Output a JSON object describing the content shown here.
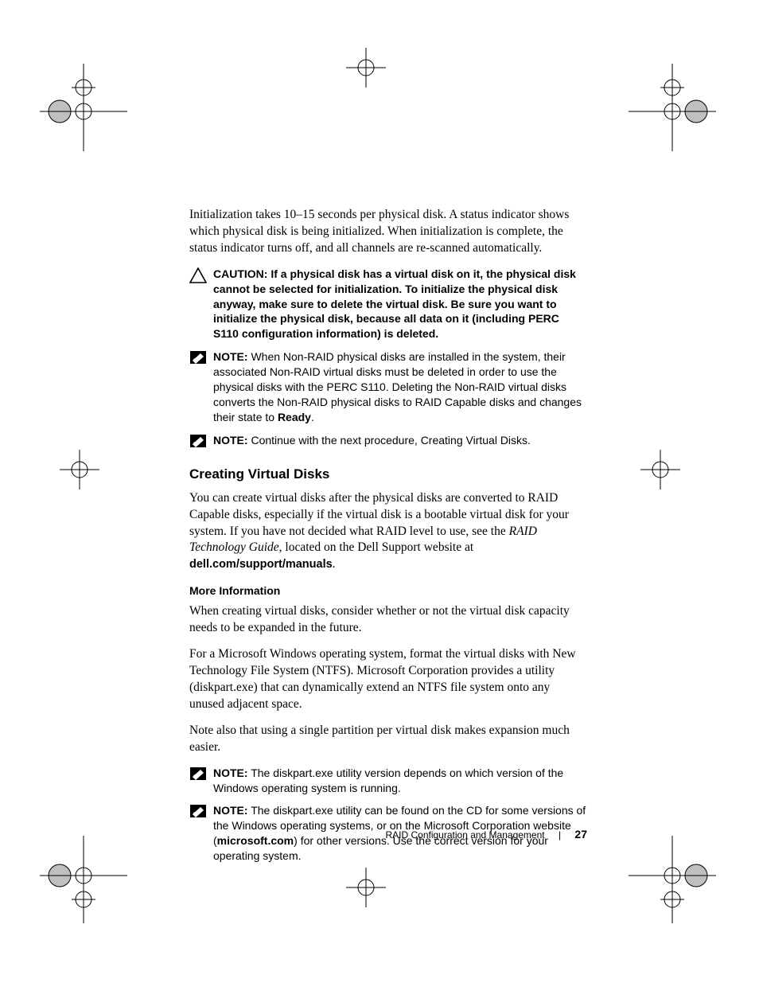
{
  "intro_paragraph": "Initialization takes 10–15 seconds per physical disk. A status indicator shows which physical disk is being initialized. When initialization is complete, the status indicator turns off, and all channels are re-scanned automatically.",
  "caution": {
    "label": "CAUTION:",
    "text": " If a physical disk has a virtual disk on it, the physical disk cannot be selected for initialization. To initialize the physical disk anyway, make sure to delete the virtual disk. Be sure you want to initialize the physical disk, because all data on it (including PERC S110 configuration information) is deleted."
  },
  "note1": {
    "label": "NOTE:",
    "text_a": " When Non-RAID physical disks are installed in the system, their associated Non-RAID virtual disks must be deleted in order to use the physical disks with the PERC S110. Deleting the Non-RAID virtual disks converts the Non-RAID physical disks to RAID Capable disks and changes their state to ",
    "bold_word": "Ready",
    "text_b": "."
  },
  "note2": {
    "label": "NOTE:",
    "text": " Continue with the next procedure, Creating Virtual Disks."
  },
  "section_heading": "Creating Virtual Disks",
  "section_para_a": "You can create virtual disks after the physical disks are converted to RAID Capable disks, especially if the virtual disk is a bootable virtual disk for your system. If you have not decided what RAID level to use, see the ",
  "section_para_italic": "RAID Technology Guide",
  "section_para_b": ", located on the Dell Support website at ",
  "section_para_bold": "dell.com/support/manuals",
  "section_para_c": ".",
  "more_info_heading": "More Information",
  "more_info_p1": "When creating virtual disks, consider whether or not the virtual disk capacity needs to be expanded in the future.",
  "more_info_p2": "For a Microsoft Windows operating system, format the virtual disks with New Technology File System (NTFS). Microsoft Corporation provides a utility (diskpart.exe) that can dynamically extend an NTFS file system onto any unused adjacent space.",
  "more_info_p3": "Note also that using a single partition per virtual disk makes expansion much easier.",
  "note3": {
    "label": "NOTE:",
    "text": " The diskpart.exe utility version depends on which version of the Windows operating system is running."
  },
  "note4": {
    "label": "NOTE:",
    "text_a": " The diskpart.exe utility can be found on the CD for some versions of the Windows operating systems, or on the Microsoft Corporation website (",
    "bold_word": "microsoft.com",
    "text_b": ") for other versions. Use the correct version for your operating system."
  },
  "footer": {
    "title": "RAID Configuration and Management",
    "sep": "|",
    "page_number": "27"
  }
}
